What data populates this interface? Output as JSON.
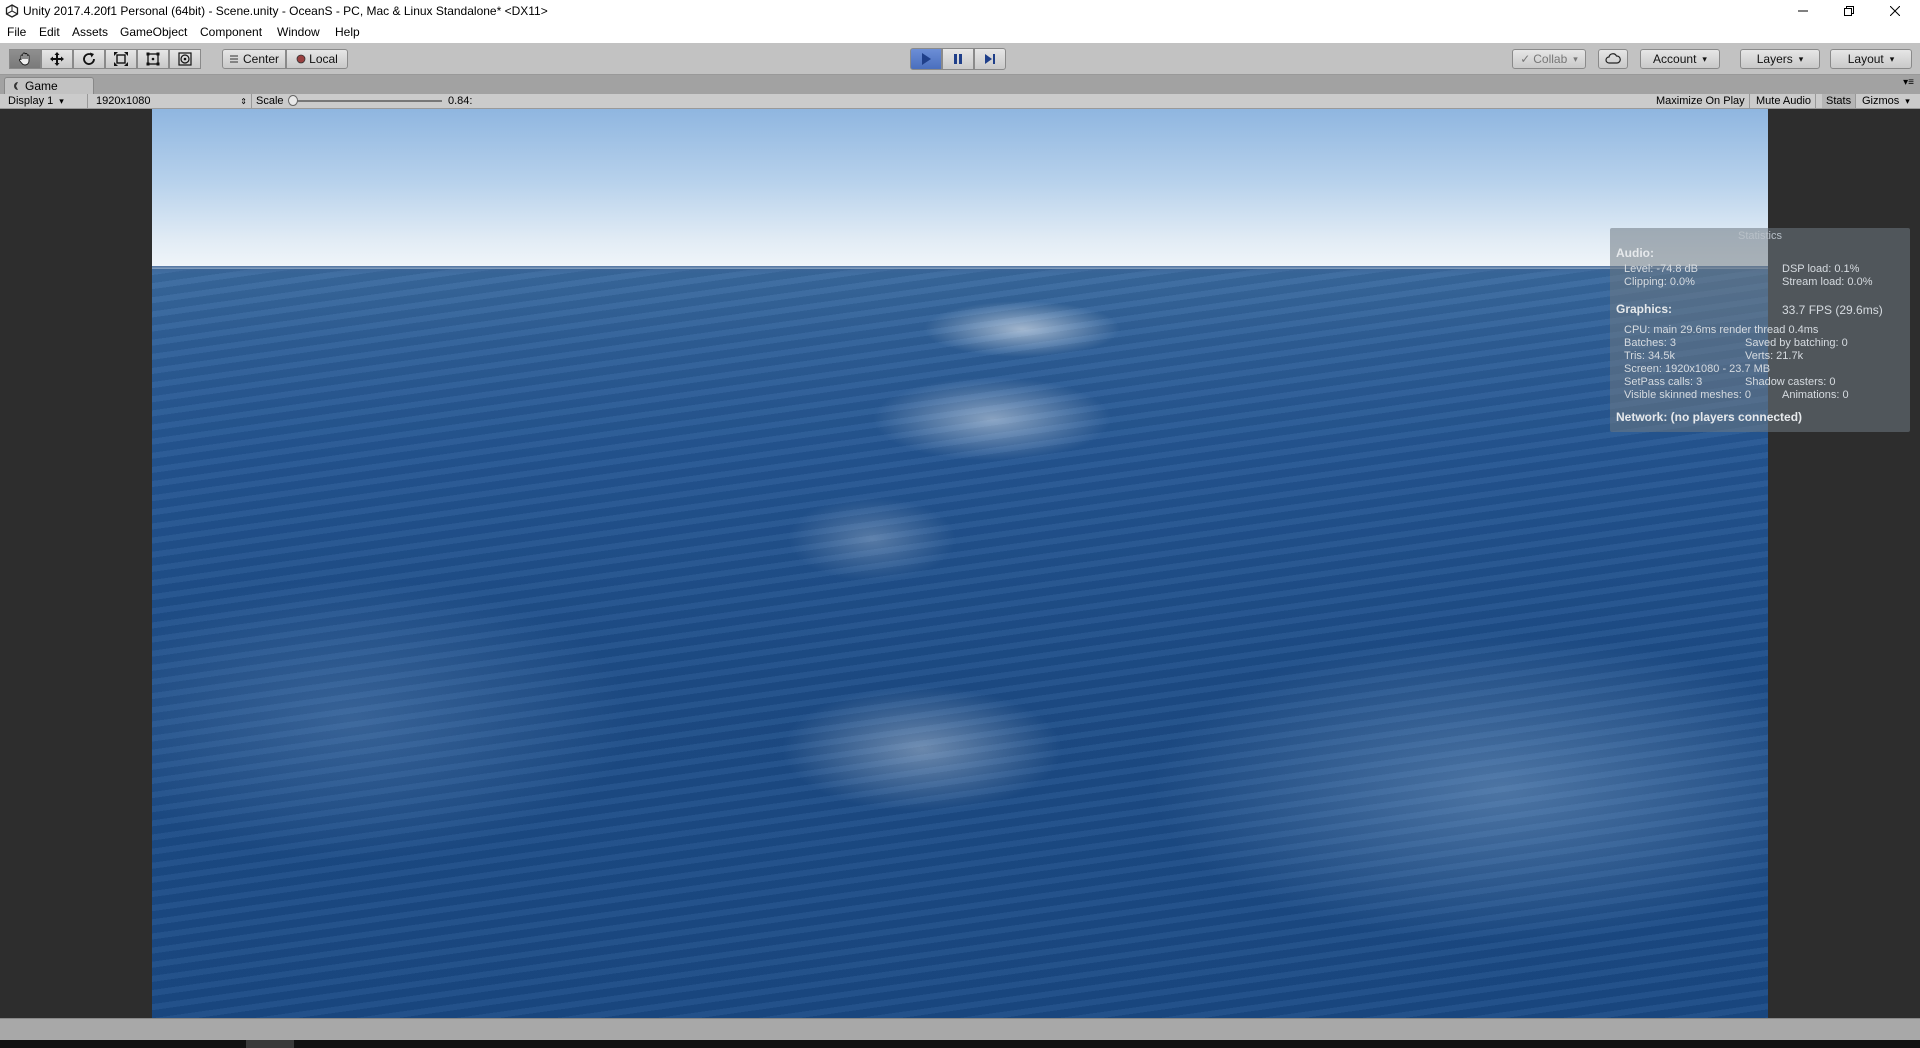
{
  "window": {
    "title": "Unity 2017.4.20f1 Personal (64bit) - Scene.unity - OceanS - PC, Mac & Linux Standalone* <DX11>",
    "minimize_icon": "minimize-icon",
    "maximize_icon": "restore-icon",
    "close_icon": "close-icon"
  },
  "menu": {
    "items": [
      "File",
      "Edit",
      "Assets",
      "GameObject",
      "Component",
      "Window",
      "Help"
    ]
  },
  "toolbar": {
    "tools": [
      "hand-icon",
      "move-icon",
      "rotate-icon",
      "scale-icon",
      "rect-icon",
      "transform-icon"
    ],
    "pivot_label": "Center",
    "space_label": "Local",
    "play_icon": "play-icon",
    "pause_icon": "pause-icon",
    "step_icon": "step-icon",
    "collab_label": "Collab",
    "account_label": "Account",
    "layers_label": "Layers",
    "layout_label": "Layout"
  },
  "game_tab": {
    "label": "Game"
  },
  "game_bar": {
    "display": "Display 1",
    "resolution": "1920x1080",
    "scale_label": "Scale",
    "scale_value": "0.84:",
    "maximize_on_play": "Maximize On Play",
    "mute_audio": "Mute Audio",
    "stats": "Stats",
    "gizmos": "Gizmos"
  },
  "statistics": {
    "title": "Statistics",
    "audio_header": "Audio:",
    "level": "Level: -74.8 dB",
    "clipping": "Clipping: 0.0%",
    "dsp_load": "DSP load: 0.1%",
    "stream_load": "Stream load: 0.0%",
    "graphics_header": "Graphics:",
    "fps": "33.7 FPS (29.6ms)",
    "cpu": "CPU: main 29.6ms  render thread 0.4ms",
    "batches": "Batches: 3",
    "saved_by_batching": "Saved by batching: 0",
    "tris": "Tris: 34.5k",
    "verts": "Verts: 21.7k",
    "screen": "Screen: 1920x1080 - 23.7 MB",
    "setpass": "SetPass calls: 3",
    "shadow_casters": "Shadow casters: 0",
    "skinned_meshes": "Visible skinned meshes: 0",
    "animations": "Animations: 0",
    "network": "Network: (no players connected)"
  }
}
